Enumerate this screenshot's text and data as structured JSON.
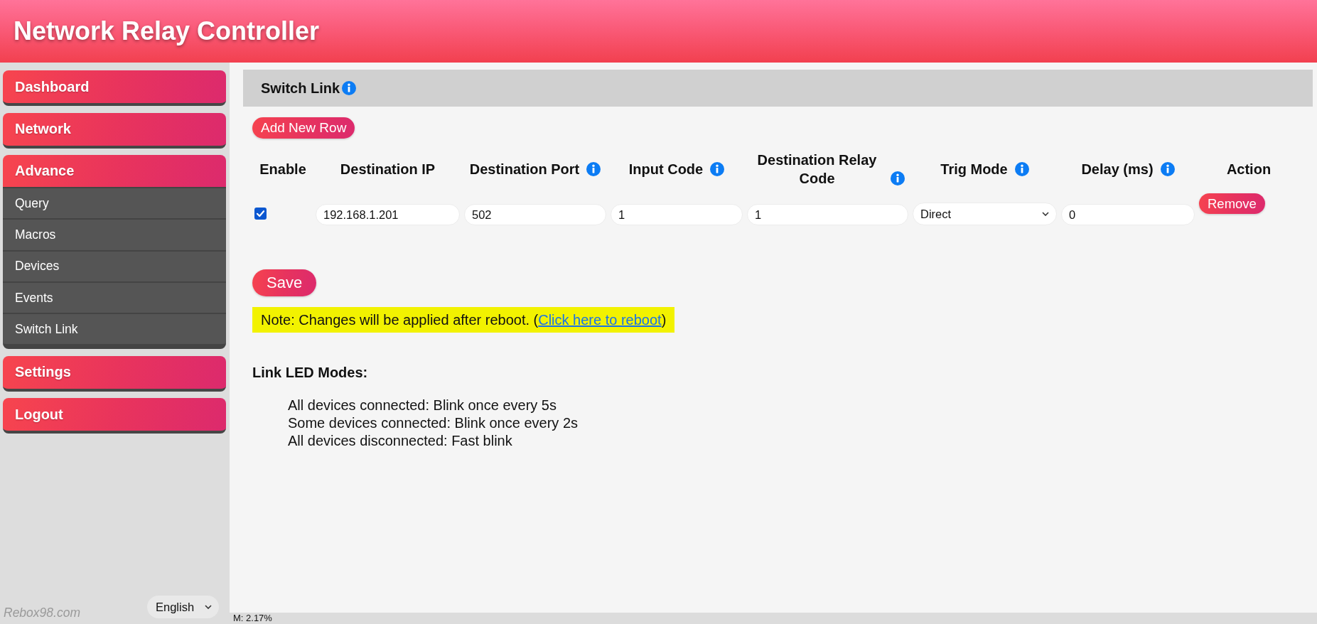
{
  "header": {
    "title": "Network Relay Controller"
  },
  "sidebar": {
    "menu": [
      {
        "label": "Dashboard",
        "expanded": false
      },
      {
        "label": "Network",
        "expanded": false
      },
      {
        "label": "Advance",
        "expanded": true,
        "children": [
          {
            "label": "Query"
          },
          {
            "label": "Macros"
          },
          {
            "label": "Devices"
          },
          {
            "label": "Events"
          },
          {
            "label": "Switch Link"
          }
        ]
      },
      {
        "label": "Settings",
        "expanded": false
      },
      {
        "label": "Logout",
        "expanded": false
      }
    ],
    "brand": "Rebox98.com",
    "language": {
      "value": "English"
    }
  },
  "section": {
    "title": "Switch Link",
    "info": true
  },
  "add_button": "Add New Row",
  "table": {
    "columns": [
      {
        "label": "Enable",
        "info": false,
        "kind": "checkbox"
      },
      {
        "label": "Destination IP",
        "info": false,
        "kind": "input"
      },
      {
        "label": "Destination Port",
        "info": true,
        "kind": "input"
      },
      {
        "label": "Input Code",
        "info": true,
        "kind": "input"
      },
      {
        "label": "Destination Relay Code",
        "info": true,
        "kind": "input"
      },
      {
        "label": "Trig Mode",
        "info": true,
        "kind": "select"
      },
      {
        "label": "Delay (ms)",
        "info": true,
        "kind": "input"
      },
      {
        "label": "Action",
        "info": false,
        "kind": "button"
      }
    ],
    "rows": [
      {
        "cells": [
          {
            "checked": true
          },
          {
            "value": "192.168.1.201"
          },
          {
            "value": "502"
          },
          {
            "value": "1"
          },
          {
            "value": "1"
          },
          {
            "value": "Direct"
          },
          {
            "value": "0"
          },
          {
            "label": "Remove"
          }
        ]
      }
    ]
  },
  "save_button": "Save",
  "note": {
    "text": "Note: Changes will be applied after reboot. (",
    "link": "Click here to reboot",
    "text_after": ")"
  },
  "led_modes": {
    "title": "Link LED Modes:",
    "lines": [
      "All devices connected: Blink once every 5s",
      "Some devices connected: Blink once every 2s",
      "All devices disconnected: Fast blink"
    ]
  },
  "status_bar": {
    "text": "M: 2.17%"
  }
}
